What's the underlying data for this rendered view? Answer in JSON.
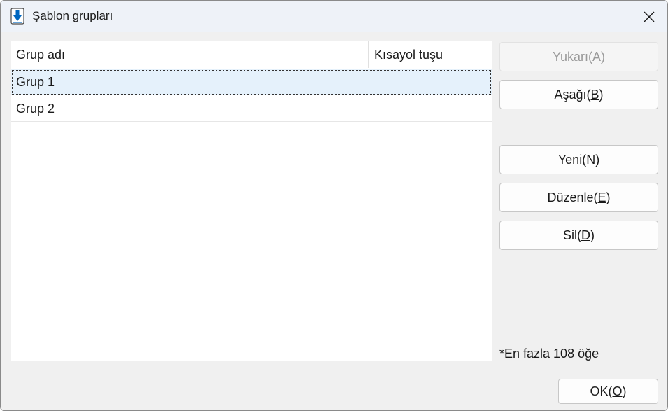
{
  "window": {
    "title": "Şablon grupları"
  },
  "list": {
    "columns": {
      "name": "Grup adı",
      "shortcut": "Kısayol tuşu"
    },
    "rows": [
      {
        "name": "Grup 1",
        "shortcut": "",
        "selected": true
      },
      {
        "name": "Grup 2",
        "shortcut": "",
        "selected": false
      }
    ]
  },
  "buttons": {
    "up": {
      "text": "Yukarı(",
      "key": "A",
      "close": ")"
    },
    "down": {
      "text": "Aşağı(",
      "key": "B",
      "close": ")"
    },
    "new": {
      "text": "Yeni(",
      "key": "N",
      "close": ")"
    },
    "edit": {
      "text": "Düzenle(",
      "key": "E",
      "close": ")"
    },
    "delete": {
      "text": "Sil(",
      "key": "D",
      "close": ")"
    },
    "ok": {
      "text": "OK(",
      "key": "O",
      "close": ")"
    }
  },
  "note": "*En fazla 108 öğe",
  "icons": {
    "title": "download-arrow-icon",
    "close": "close-icon"
  },
  "colors": {
    "accent": "#0067c0",
    "selection": "#e5f1fb"
  }
}
